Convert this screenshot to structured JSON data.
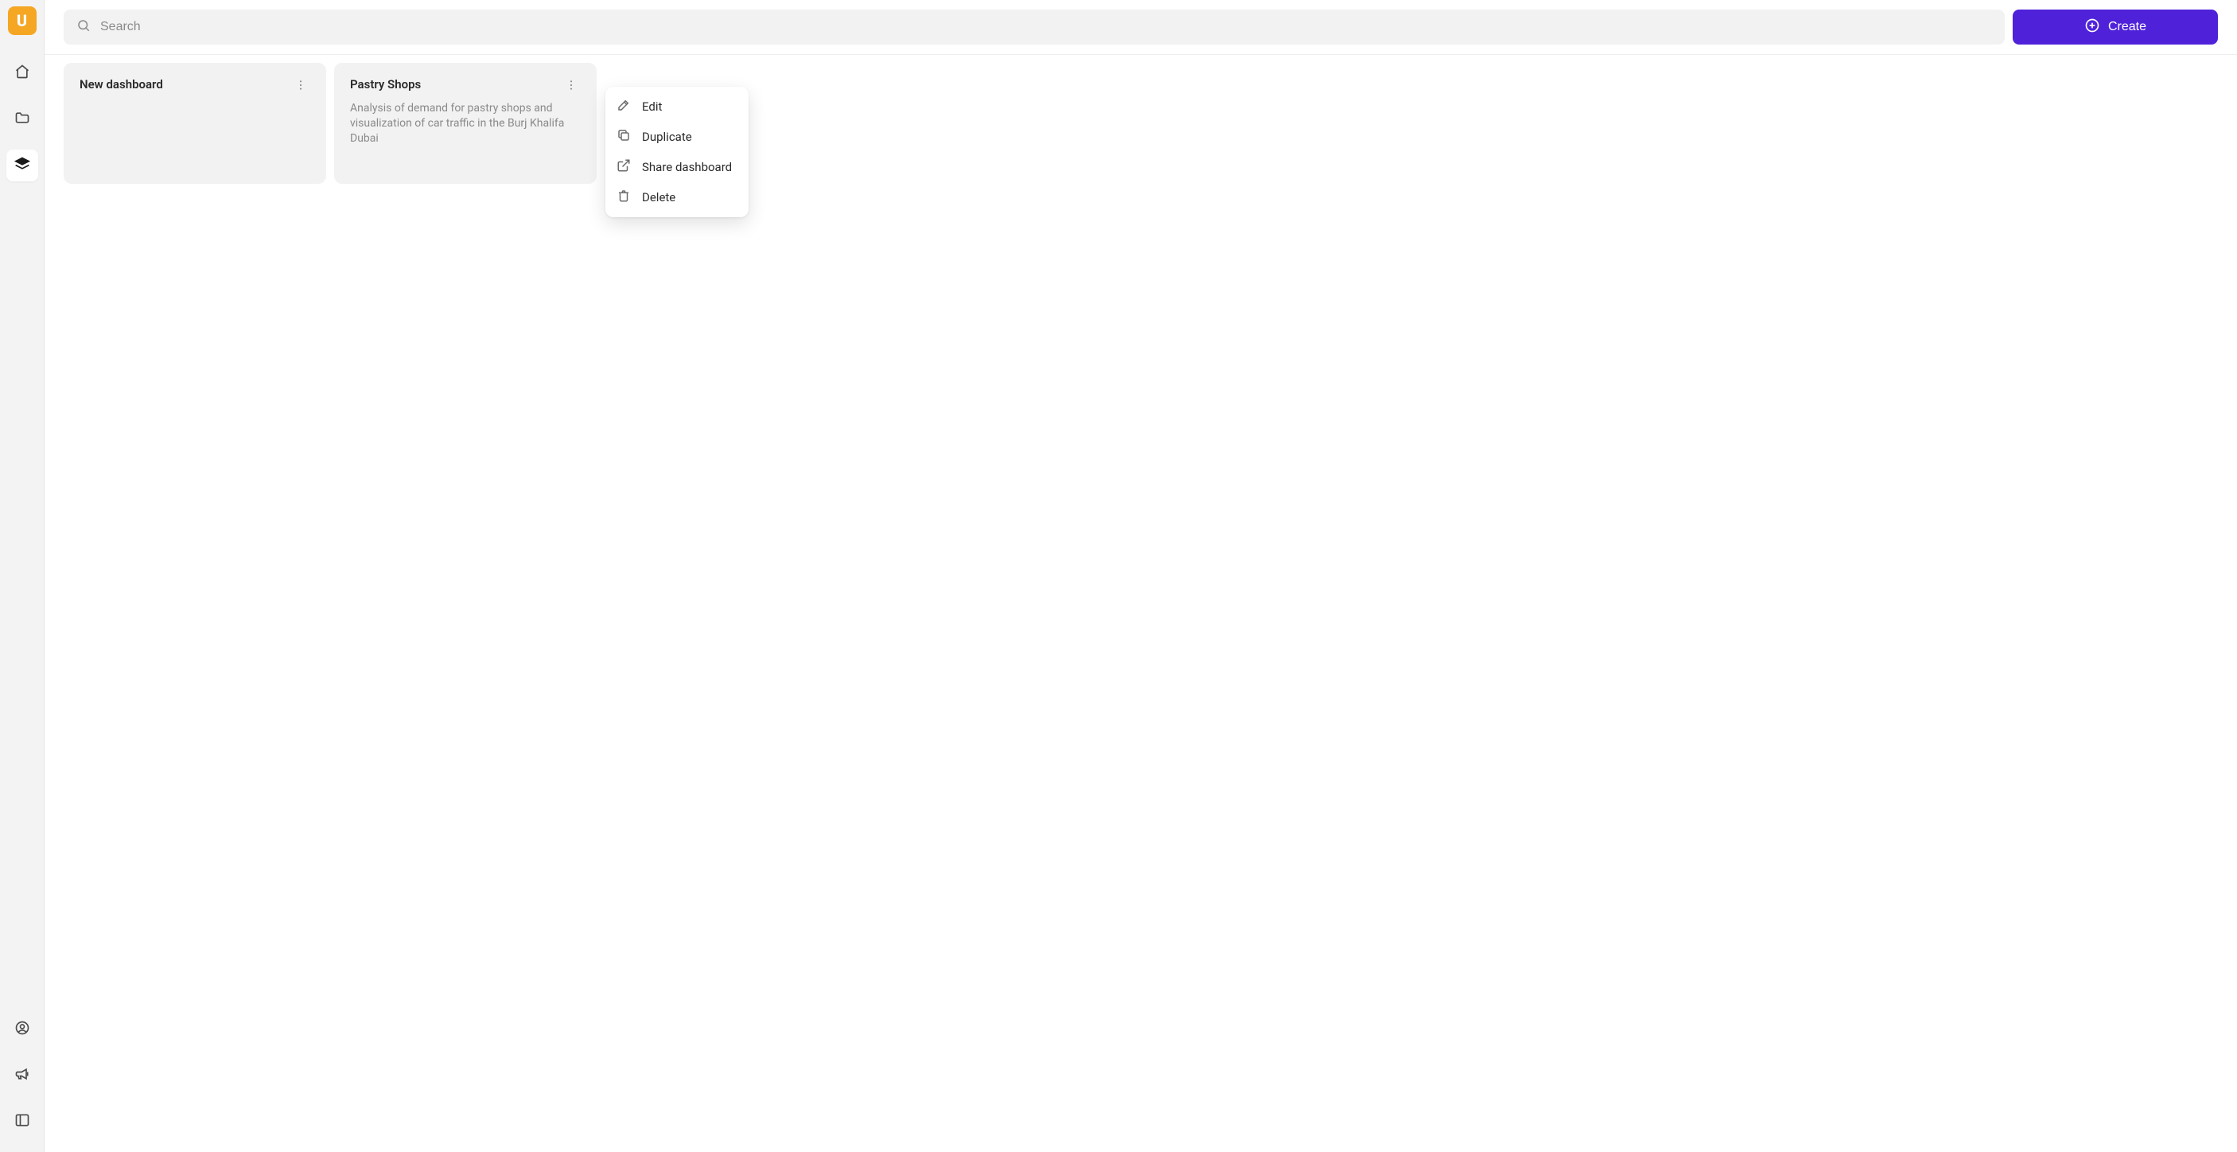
{
  "logo_letter": "U",
  "search": {
    "placeholder": "Search",
    "value": ""
  },
  "create_button": {
    "label": "Create"
  },
  "dashboards": [
    {
      "title": "New dashboard",
      "description": ""
    },
    {
      "title": "Pastry Shops",
      "description": "Analysis of demand for pastry shops and visualization of car traffic in the Burj Khalifa Dubai"
    }
  ],
  "context_menu": {
    "items": [
      {
        "label": "Edit"
      },
      {
        "label": "Duplicate"
      },
      {
        "label": "Share dashboard"
      },
      {
        "label": "Delete"
      }
    ]
  }
}
